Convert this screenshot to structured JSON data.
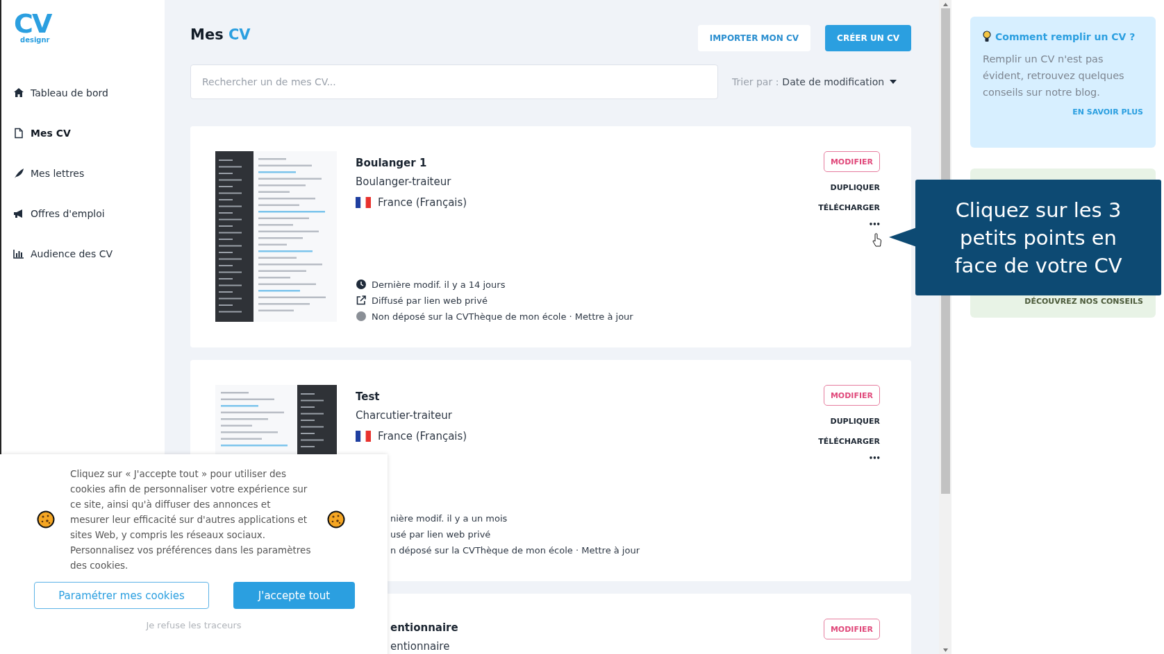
{
  "logo": {
    "mark": "CV",
    "wordmark": "designr"
  },
  "sidebar": {
    "items": [
      {
        "kind": "home",
        "label": "Tableau de bord",
        "selected": false
      },
      {
        "kind": "file",
        "label": "Mes CV",
        "selected": true
      },
      {
        "kind": "feather",
        "label": "Mes lettres",
        "selected": false
      },
      {
        "kind": "megaphone",
        "label": "Offres d'emploi",
        "selected": false
      },
      {
        "kind": "chart",
        "label": "Audience des CV",
        "selected": false
      }
    ]
  },
  "header": {
    "title": "Mes",
    "title_accent": "CV",
    "buttons": [
      {
        "kind": "secondary",
        "label": "IMPORTER MON CV"
      },
      {
        "kind": "primary",
        "label": "CRÉER UN CV"
      }
    ]
  },
  "search": {
    "placeholder": "Rechercher un de mes CV..."
  },
  "sort": {
    "label": "Trier par :",
    "value": "Date de modification"
  },
  "cv_cards": [
    {
      "covered": false,
      "thumbnail": {
        "kind": "dark-left"
      },
      "title": "Boulanger 1",
      "job": "Boulanger-traiteur",
      "country": "France (Français)",
      "meta": [
        {
          "kind": "clock",
          "text": "Dernière modif. il y a 14 jours"
        },
        {
          "kind": "share",
          "text": "Diffusé par lien web privé"
        },
        {
          "kind": "dot",
          "text": "Non déposé sur la CVThèque de mon école · Mettre à jour"
        }
      ],
      "actions": {
        "edit": "MODIFIER",
        "duplicate": "DUPLIQUER",
        "download": "TÉLÉCHARGER",
        "more": "•••"
      }
    },
    {
      "covered": false,
      "thumbnail": {
        "kind": "dark-right-top"
      },
      "title": "Test",
      "job": "Charcutier-traiteur",
      "country": "France (Français)",
      "meta": [
        {
          "kind": "hidden",
          "text": "nière modif. il y a un mois"
        },
        {
          "kind": "hidden",
          "text": "usé par lien web privé"
        },
        {
          "kind": "hidden",
          "text": "n déposé sur la CVThèque de mon école · Mettre à jour"
        }
      ],
      "actions": {
        "edit": "MODIFIER",
        "duplicate": "DUPLIQUER",
        "download": "TÉLÉCHARGER",
        "more": "•••"
      }
    },
    {
      "covered": true,
      "title": "entionnaire",
      "job": "entionnaire",
      "actions": {
        "edit": "MODIFIER"
      }
    }
  ],
  "tip_card": {
    "title": "Comment remplir un CV ?",
    "text": "Remplir un CV n'est pas évident, retrouvez quelques conseils sur notre blog.",
    "link": "EN SAVOIR PLUS"
  },
  "advice_card": {
    "link": "DÉCOUVREZ NOS CONSEILS"
  },
  "tooltip": {
    "text": "Cliquez sur les 3 petits points en face de votre CV"
  },
  "cookie_banner": {
    "text": "Cliquez sur « J'accepte tout » pour utiliser des cookies afin de personnaliser votre expérience sur ce site, ainsi qu'à diffuser des annonces et mesurer leur efficacité sur d'autres applications et sites Web, y compris les réseaux sociaux. Personnalisez vos préférences dans les paramètres des cookies.",
    "settings_button": "Paramétrer mes cookies",
    "accept_button": "J'accepte tout",
    "refuse_link": "Je refuse les traceurs"
  }
}
